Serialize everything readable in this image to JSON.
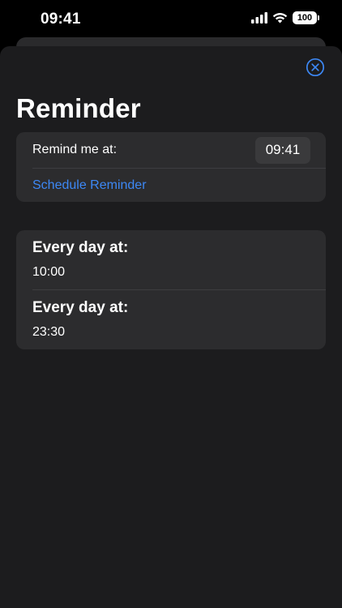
{
  "status_bar": {
    "time": "09:41",
    "battery": "100"
  },
  "sheet": {
    "title": "Reminder",
    "remind_row": {
      "label": "Remind me at:",
      "time": "09:41"
    },
    "schedule_action": "Schedule Reminder",
    "reminders": [
      {
        "heading": "Every day at:",
        "time": "10:00"
      },
      {
        "heading": "Every day at:",
        "time": "23:30"
      }
    ]
  },
  "colors": {
    "accent": "#3d88f5",
    "sheet_background": "#1c1c1e",
    "group_background": "#2c2c2e"
  }
}
